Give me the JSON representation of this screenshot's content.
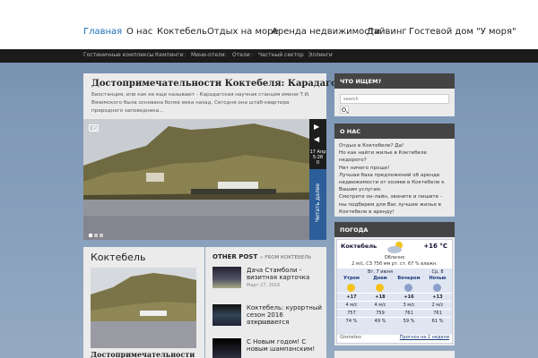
{
  "nav": {
    "items": [
      {
        "label": "Главная",
        "active": true
      },
      {
        "label": "О нас"
      },
      {
        "label": "Коктебель"
      },
      {
        "label": "Отдых на море"
      },
      {
        "label": "Аренда недвижимости"
      },
      {
        "label": "Дайвинг"
      },
      {
        "label": "Гостевой дом \"У моря\""
      }
    ]
  },
  "subnav": {
    "items": [
      "Гостиничные комплексы",
      "Кемпинги",
      "Мини-отели",
      "Отели",
      "Частный сектор",
      "Эллинги"
    ],
    "separator": "::"
  },
  "featured": {
    "title": "Достопримечательности Коктебеля: Карадагская",
    "excerpt": "Биостанция, или как ее еще называют - Карадагская научная станция имени Т.И. Вяземского была основана более века назад. Сегодня она штаб-квартира природного заповедника...",
    "date_day": "17 Апр",
    "date_time": "5:28",
    "date_comments": "0",
    "prev_arrow": "◀",
    "next_arrow": "▶",
    "read_more": "Читать далее"
  },
  "category": {
    "title": "Коктебель",
    "post_title": "Достопримечательности"
  },
  "other_posts": {
    "heading": "OTHER POST",
    "from": "» FROM КОКТЕБЕЛЬ",
    "items": [
      {
        "title": "Дача Стамболи - визитная карточка",
        "date": "Март 27, 2016"
      },
      {
        "title": "Коктебель: курортный сезон 2016 открывается",
        "date": "Март 17, 2016"
      },
      {
        "title": "С Новым годом! С новым шампанским!",
        "date": ""
      }
    ]
  },
  "sidebar": {
    "search": {
      "heading": "ЧТО ИЩЕМ?",
      "placeholder": "search"
    },
    "about": {
      "heading": "О НАС",
      "lines": [
        "Отдых в Коктебеле? Да!",
        "Но как найти жилье в Коктебеле недорого?",
        "Нет ничего проще!",
        "Лучшая база предложений об аренде недвижимости от хозяев в Коктебеле к Вашим услугам.",
        "Смотрите он-лайн, звоните и пишите - мы подберем для Вас лучшее жилье в Коктебеле в аренду!"
      ]
    },
    "weather": {
      "heading": "ПОГОДА",
      "city": "Коктебель",
      "temp": "+16 °C",
      "desc": "Облачно",
      "details": "2 м/с, СЗ   756 мм рт. ст.   67 % влажн.",
      "forecast": [
        {
          "date": "",
          "label": "Утром",
          "icon": "sun",
          "temp": "+17",
          "wind": "4 м/с",
          "pressure": "757",
          "humidity": "74 %"
        },
        {
          "date": "Вт, 7 июня",
          "label": "Днем",
          "icon": "sun",
          "temp": "+18",
          "wind": "4 м/с",
          "pressure": "759",
          "humidity": "49 %"
        },
        {
          "date": "",
          "label": "Вечером",
          "icon": "moon",
          "temp": "+16",
          "wind": "3 м/с",
          "pressure": "761",
          "humidity": "59 %"
        },
        {
          "date": "Ср, 8",
          "label": "Ночью",
          "icon": "moon",
          "temp": "+13",
          "wind": "2 м/с",
          "pressure": "761",
          "humidity": "61 %"
        }
      ],
      "source": "Gismeteo",
      "link": "Прогноз на 2 недели"
    }
  }
}
